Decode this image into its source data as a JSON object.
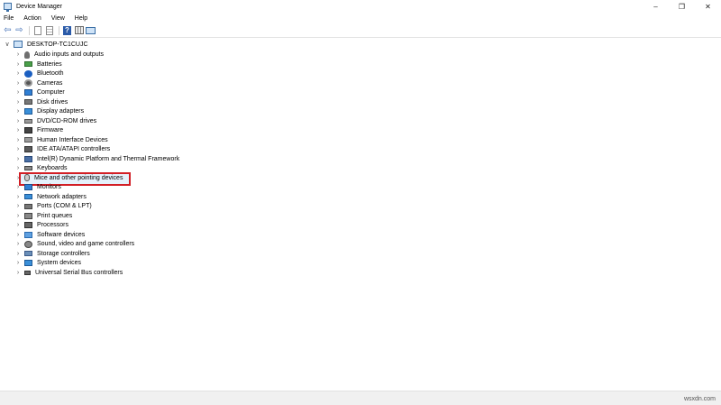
{
  "window": {
    "title": "Device Manager",
    "minimize": "–",
    "restore": "❐",
    "close": "✕"
  },
  "menu": [
    "File",
    "Action",
    "View",
    "Help"
  ],
  "tree": {
    "root": "DESKTOP-TC1CUJC",
    "items": [
      {
        "label": "Audio inputs and outputs",
        "icon": "speaker-icon"
      },
      {
        "label": "Batteries",
        "icon": "battery-icon"
      },
      {
        "label": "Bluetooth",
        "icon": "bluetooth-icon"
      },
      {
        "label": "Cameras",
        "icon": "camera-icon"
      },
      {
        "label": "Computer",
        "icon": "computer-icon"
      },
      {
        "label": "Disk drives",
        "icon": "disk-drive-icon"
      },
      {
        "label": "Display adapters",
        "icon": "display-adapter-icon"
      },
      {
        "label": "DVD/CD-ROM drives",
        "icon": "dvd-drive-icon"
      },
      {
        "label": "Firmware",
        "icon": "firmware-icon"
      },
      {
        "label": "Human Interface Devices",
        "icon": "hid-icon"
      },
      {
        "label": "IDE ATA/ATAPI controllers",
        "icon": "ide-controller-icon"
      },
      {
        "label": "Intel(R) Dynamic Platform and Thermal Framework",
        "icon": "intel-framework-icon"
      },
      {
        "label": "Keyboards",
        "icon": "keyboard-icon"
      },
      {
        "label": "Mice and other pointing devices",
        "icon": "mouse-icon"
      },
      {
        "label": "Monitors",
        "icon": "monitor-icon"
      },
      {
        "label": "Network adapters",
        "icon": "network-adapter-icon"
      },
      {
        "label": "Ports (COM & LPT)",
        "icon": "port-icon"
      },
      {
        "label": "Print queues",
        "icon": "printer-icon"
      },
      {
        "label": "Processors",
        "icon": "processor-icon"
      },
      {
        "label": "Software devices",
        "icon": "software-device-icon"
      },
      {
        "label": "Sound, video and game controllers",
        "icon": "sound-controller-icon"
      },
      {
        "label": "Storage controllers",
        "icon": "storage-controller-icon"
      },
      {
        "label": "System devices",
        "icon": "system-device-icon"
      },
      {
        "label": "Universal Serial Bus controllers",
        "icon": "usb-icon"
      }
    ],
    "selected": "Mice and other pointing devices"
  },
  "watermark": "wsxdn.com",
  "colors": {
    "highlight_border": "#d21f26",
    "selection_bg": "#e5f1fb",
    "accent": "#3a6ea5"
  }
}
